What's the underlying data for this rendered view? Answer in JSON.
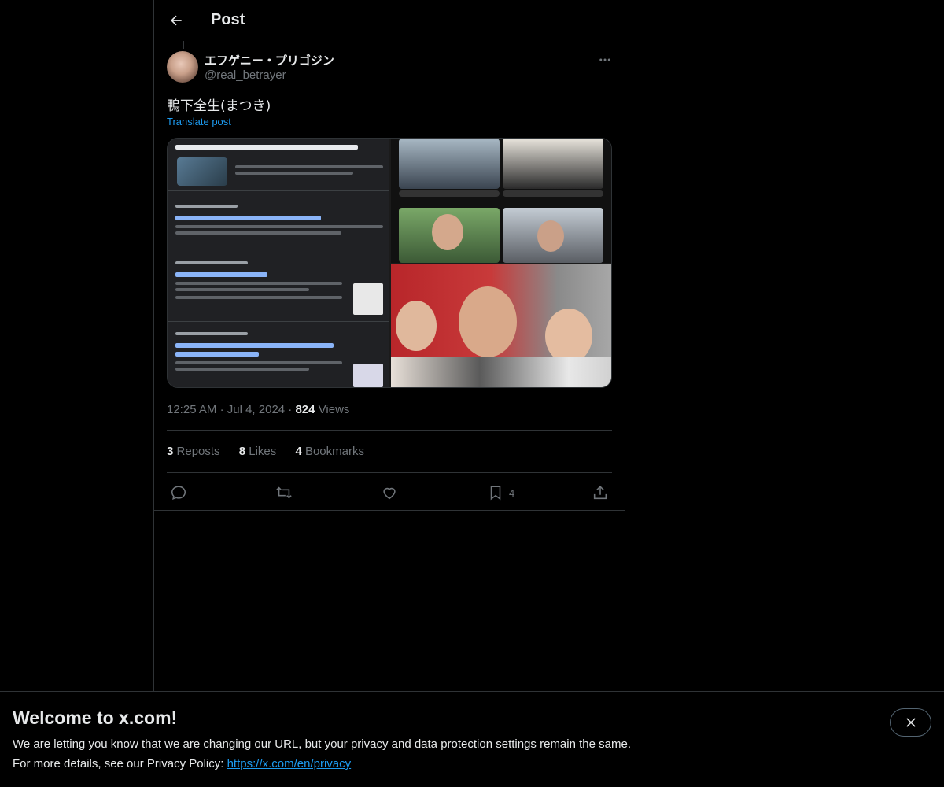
{
  "header": {
    "title": "Post"
  },
  "post": {
    "author_name": "エフゲニー・プリゴジン",
    "author_handle": "@real_betrayer",
    "text": "鴨下全生(まつき)",
    "translate_label": "Translate post",
    "time": "12:25 AM",
    "date": "Jul 4, 2024",
    "separator": "·",
    "views_count": "824",
    "views_label": "Views"
  },
  "stats": {
    "reposts": {
      "count": "3",
      "label": "Reposts"
    },
    "likes": {
      "count": "8",
      "label": "Likes"
    },
    "bookmarks": {
      "count": "4",
      "label": "Bookmarks"
    }
  },
  "actions": {
    "bookmark_count": "4"
  },
  "banner": {
    "title": "Welcome to x.com!",
    "line1": "We are letting you know that we are changing our URL, but your privacy and data protection settings remain the same.",
    "line2_prefix": "For more details, see our Privacy Policy: ",
    "link": "https://x.com/en/privacy"
  },
  "icons": {
    "back": "arrow-left-icon",
    "more": "more-horizontal-icon",
    "reply": "reply-icon",
    "repost": "repost-icon",
    "like": "heart-icon",
    "bookmark": "bookmark-icon",
    "share": "share-icon",
    "close": "close-icon"
  },
  "colors": {
    "accent": "#1d9bf0",
    "muted": "#71767b",
    "text": "#e7e9ea",
    "border": "#2f3336"
  }
}
